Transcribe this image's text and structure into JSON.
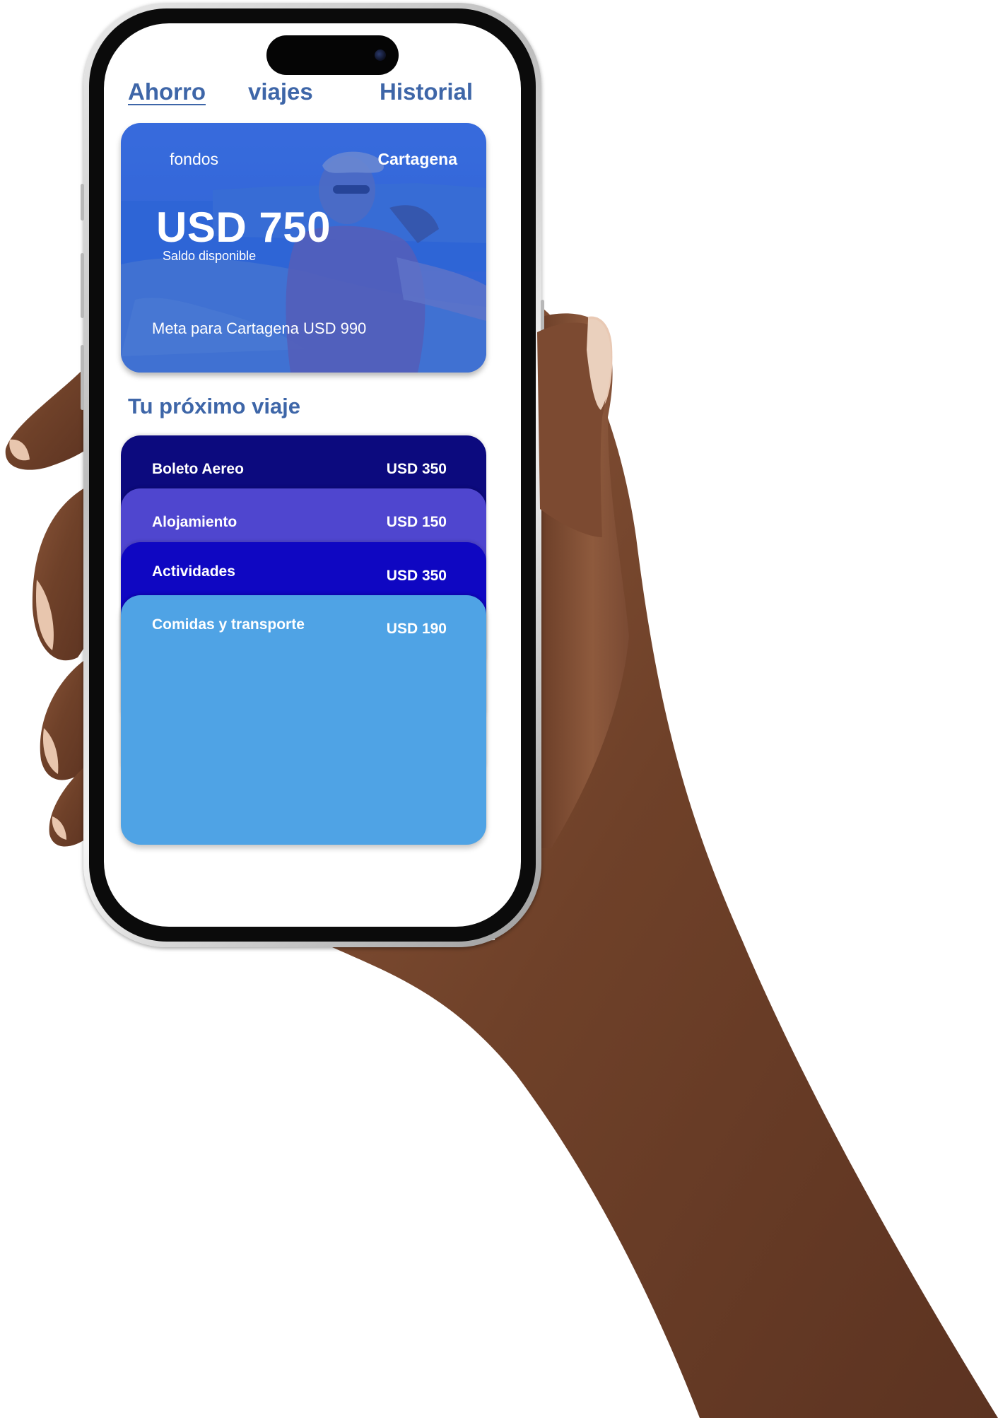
{
  "tabs": [
    {
      "label": "Ahorro",
      "active": true
    },
    {
      "label": "viajes",
      "active": false
    },
    {
      "label": "Historial",
      "active": false
    }
  ],
  "savings_card": {
    "funds_label": "fondos",
    "destination": "Cartagena",
    "amount": "USD 750",
    "balance_label": "Saldo disponible",
    "goal_text": "Meta para Cartagena USD 990"
  },
  "next_trip": {
    "title": "Tu próximo viaje",
    "expenses": [
      {
        "name": "Boleto Aereo",
        "amount": "USD 350",
        "color": "#0c0a7e"
      },
      {
        "name": "Alojamiento",
        "amount": "USD 150",
        "color": "#4f46cf"
      },
      {
        "name": "Actividades",
        "amount": "USD 350",
        "color": "#0f07c2"
      },
      {
        "name": "Comidas y transporte",
        "amount": "USD 190",
        "color": "#4fa3e5"
      }
    ]
  },
  "colors": {
    "accent_text": "#3e66a8",
    "card_overlay": "#2f63d8",
    "skin": "#7a4a33"
  }
}
